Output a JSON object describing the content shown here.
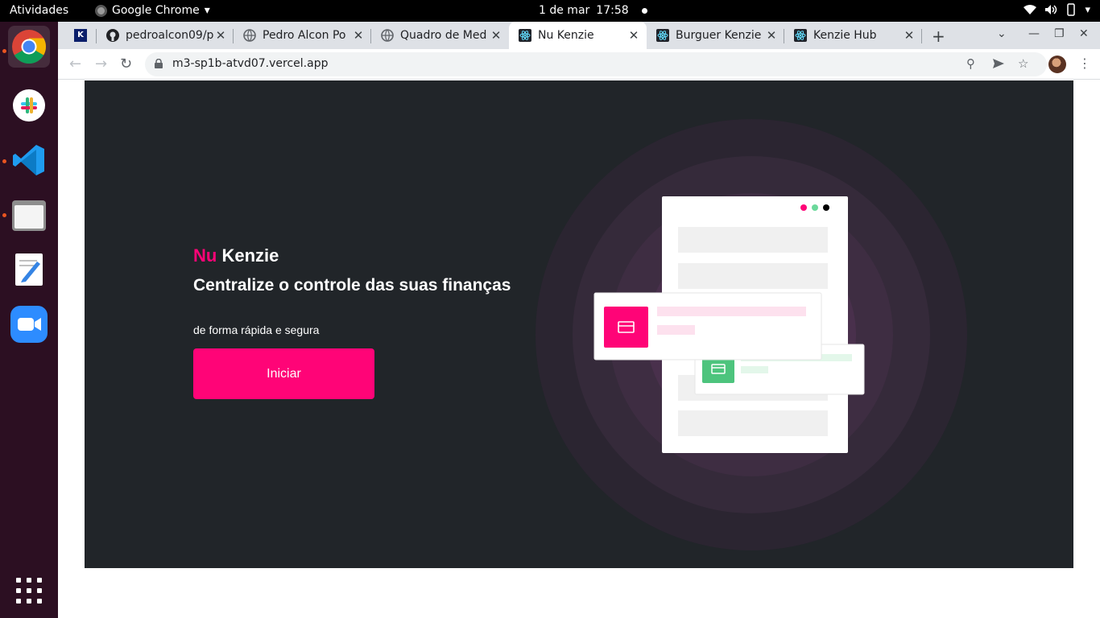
{
  "system": {
    "activities": "Atividades",
    "app_menu": "Google Chrome",
    "date": "1 de mar",
    "time": "17:58"
  },
  "browser": {
    "tabs": [
      {
        "title": "",
        "icon": "kenzie-k-icon",
        "active": false
      },
      {
        "title": "pedroalcon09/p",
        "icon": "github-icon",
        "active": false
      },
      {
        "title": "Pedro Alcon Po",
        "icon": "globe-icon",
        "active": false
      },
      {
        "title": "Quadro de Med",
        "icon": "globe-icon",
        "active": false
      },
      {
        "title": "Nu Kenzie",
        "icon": "react-icon",
        "active": true
      },
      {
        "title": "Burguer Kenzie",
        "icon": "react-icon",
        "active": false
      },
      {
        "title": "Kenzie Hub",
        "icon": "react-icon",
        "active": false
      }
    ],
    "url": "m3-sp1b-atvd07.vercel.app"
  },
  "page": {
    "brand_nu": "Nu",
    "brand_kenzie": "Kenzie",
    "headline": "Centralize o controle das suas finanças",
    "subheadline": "de forma rápida e segura",
    "cta_label": "Iniciar"
  },
  "colors": {
    "accent": "#ff0477",
    "background": "#212529",
    "success": "#03b898"
  }
}
